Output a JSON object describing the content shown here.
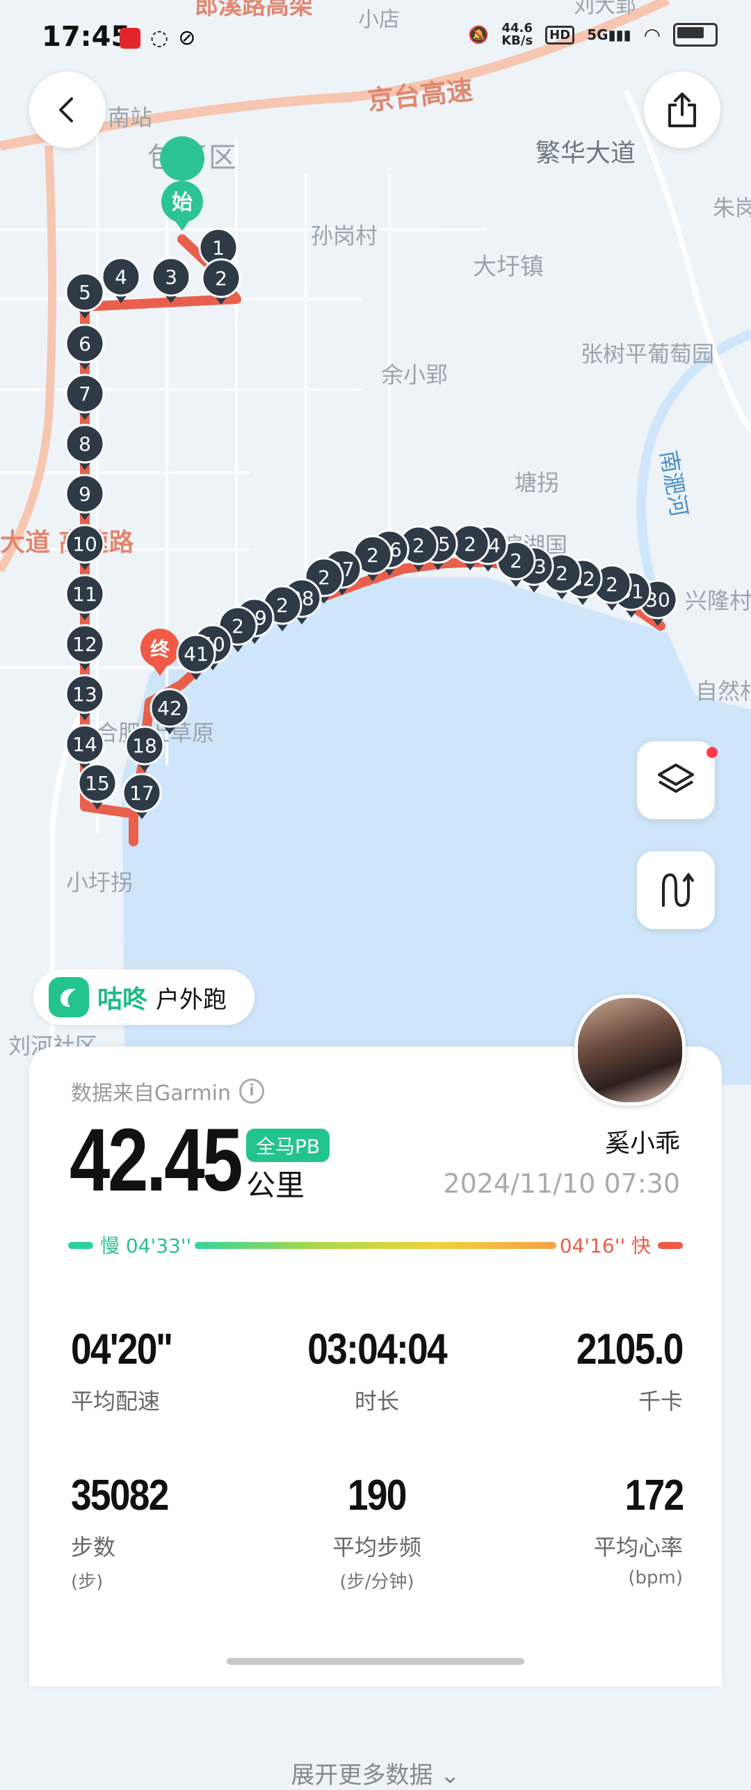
{
  "status_bar": {
    "time": "17:45",
    "net_speed": "44.6",
    "net_unit": "KB/s",
    "hd": "HD",
    "signal": "5G"
  },
  "map": {
    "labels": [
      "郎溪路高架",
      "小店",
      "刘大郢",
      "南站",
      "包河区",
      "京台高速",
      "繁华大道",
      "孙岗村",
      "大圩镇",
      "余小郢",
      "张树平葡萄园",
      "南淝河",
      "塘拐",
      "滨湖国",
      "兴隆村",
      "自然村",
      "大道 高速路",
      "合肥 上草原",
      "小圩拐",
      "刘河社区",
      "朱岗"
    ],
    "start_label": "始",
    "end_label": "终",
    "km_markers": [
      "1",
      "2",
      "3",
      "4",
      "5",
      "6",
      "7",
      "8",
      "9",
      "10",
      "11",
      "12",
      "13",
      "14",
      "15",
      "17",
      "18",
      "30",
      "31",
      "2",
      "32",
      "2",
      "33",
      "2",
      "34",
      "2",
      "35",
      "2",
      "36",
      "2",
      "37",
      "2",
      "38",
      "2",
      "39",
      "2",
      "40",
      "41",
      "42"
    ]
  },
  "brand": {
    "name": "咕咚",
    "activity_type": "户外跑"
  },
  "colors": {
    "accent": "#22c38e",
    "route": "#e8604c",
    "marker": "#2f3a47",
    "water": "#cfe6fa"
  },
  "summary": {
    "source": "数据来自Garmin",
    "distance": "42.45",
    "pb_badge": "全马PB",
    "unit": "公里",
    "username": "奚小乖",
    "datetime": "2024/11/10 07:30",
    "pace_slow": "慢 04'33''",
    "pace_fast": "04'16'' 快"
  },
  "stats": [
    {
      "value": "04'20''",
      "label": "平均配速",
      "sub": ""
    },
    {
      "value": "03:04:04",
      "label": "时长",
      "sub": ""
    },
    {
      "value": "2105.0",
      "label": "千卡",
      "sub": ""
    },
    {
      "value": "35082",
      "label": "步数",
      "sub": "(步)"
    },
    {
      "value": "190",
      "label": "平均步频",
      "sub": "(步/分钟)"
    },
    {
      "value": "172",
      "label": "平均心率",
      "sub": "(bpm)"
    }
  ],
  "expand_label": "展开更多数据"
}
